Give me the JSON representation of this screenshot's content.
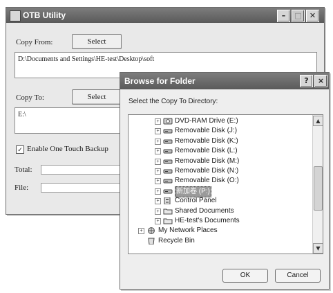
{
  "otb_window": {
    "title": "OTB Utility",
    "copy_from_label": "Copy From:",
    "copy_from_button": "Select",
    "copy_from_path": "D:\\Documents and Settings\\HE-test\\Desktop\\soft",
    "copy_to_label": "Copy To:",
    "copy_to_button": "Select",
    "copy_to_path": "E:\\",
    "one_touch_label": "Enable One Touch Backup",
    "one_touch_checked": true,
    "total_label": "Total:",
    "file_label": "File:"
  },
  "browse_dialog": {
    "title": "Browse for Folder",
    "help_button": "?",
    "close_button": "×",
    "instruction": "Select the Copy To Directory:",
    "tree_items": [
      {
        "label": "DVD-RAM Drive (E:)",
        "icon": "dvd-drive-icon",
        "expander": "+"
      },
      {
        "label": "Removable Disk (J:)",
        "icon": "removable-disk-icon",
        "expander": "+"
      },
      {
        "label": "Removable Disk (K:)",
        "icon": "removable-disk-icon",
        "expander": "+"
      },
      {
        "label": "Removable Disk (L:)",
        "icon": "removable-disk-icon",
        "expander": "+"
      },
      {
        "label": "Removable Disk (M:)",
        "icon": "removable-disk-icon",
        "expander": "+"
      },
      {
        "label": "Removable Disk (N:)",
        "icon": "removable-disk-icon",
        "expander": "+"
      },
      {
        "label": "Removable Disk (O:)",
        "icon": "removable-disk-icon",
        "expander": "+"
      },
      {
        "label": "新加卷 (P:)",
        "icon": "removable-disk-icon",
        "expander": "+",
        "selected": true
      },
      {
        "label": "Control Panel",
        "icon": "control-panel-icon",
        "expander": "+"
      },
      {
        "label": "Shared Documents",
        "icon": "folder-icon",
        "expander": "+"
      },
      {
        "label": "HE-test's Documents",
        "icon": "folder-icon",
        "expander": "+"
      },
      {
        "label": "My Network Places",
        "icon": "network-places-icon",
        "expander": "+"
      },
      {
        "label": "Recycle Bin",
        "icon": "recycle-bin-icon",
        "expander": ""
      }
    ],
    "ok_button": "OK",
    "cancel_button": "Cancel"
  }
}
